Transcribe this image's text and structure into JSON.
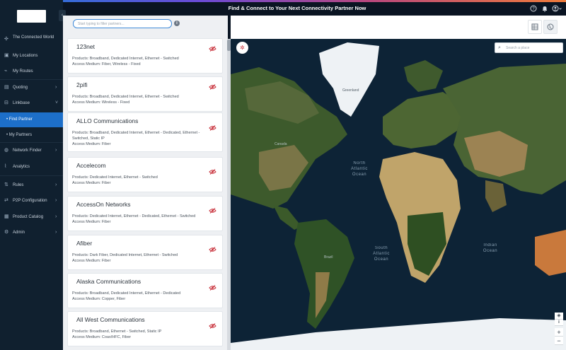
{
  "app": {
    "title": "Find & Connect to Your Next Connectivity Partner Now"
  },
  "topbar_icons": [
    "help-icon",
    "bell-icon",
    "user-icon"
  ],
  "sidebar": {
    "collapse_icon": "chevron-left-icon",
    "items": [
      {
        "label": "The Connected World",
        "icon": "network-icon",
        "chevron": false
      },
      {
        "label": "My Locations",
        "icon": "location-icon",
        "chevron": false
      },
      {
        "label": "My Routes",
        "icon": "route-icon",
        "chevron": false
      },
      {
        "label": "Quoting",
        "icon": "quote-icon",
        "chevron": true
      },
      {
        "label": "Linkbase",
        "icon": "linkbase-icon",
        "chevron": true
      },
      {
        "label": "• Find Partner",
        "icon": "",
        "chevron": false,
        "active": true
      },
      {
        "label": "• My Partners",
        "icon": "",
        "chevron": false
      },
      {
        "label": "Network Finder",
        "icon": "globe-icon",
        "chevron": true
      },
      {
        "label": "Analytics",
        "icon": "analytics-icon",
        "chevron": false
      },
      {
        "label": "Rules",
        "icon": "rules-icon",
        "chevron": true
      },
      {
        "label": "P2P Configuration",
        "icon": "p2p-icon",
        "chevron": true
      },
      {
        "label": "Product Catalog",
        "icon": "catalog-icon",
        "chevron": true
      },
      {
        "label": "Admin",
        "icon": "admin-icon",
        "chevron": true
      }
    ]
  },
  "search": {
    "placeholder": "Start typing to filter partners..."
  },
  "partners": [
    {
      "name": "123net",
      "products": "Products: Broadband, Dedicated Internet, Ethernet - Switched",
      "medium": "Access Medium: Fiber, Wireless - Fixed"
    },
    {
      "name": "2pifi",
      "products": "Products: Broadband, Dedicated Internet, Ethernet - Switched",
      "medium": "Access Medium: Wireless - Fixed"
    },
    {
      "name": "ALLO Communications",
      "products": "Products: Broadband, Dedicated Internet, Ethernet - Dedicated, Ethernet - Switched, Static IP",
      "medium": "Access Medium: Fiber"
    },
    {
      "name": "Accelecom",
      "products": "Products: Dedicated Internet, Ethernet - Switched",
      "medium": "Access Medium: Fiber"
    },
    {
      "name": "AccessOn Networks",
      "products": "Products: Dedicated Internet, Ethernet - Dedicated, Ethernet - Switched",
      "medium": "Access Medium: Fiber"
    },
    {
      "name": "Afiber",
      "products": "Products: Dark Fiber, Dedicated Internet, Ethernet - Switched",
      "medium": "Access Medium: Fiber"
    },
    {
      "name": "Alaska Communications",
      "products": "Products: Broadband, Dedicated Internet, Ethernet - Dedicated",
      "medium": "Access Medium: Copper, Fiber"
    },
    {
      "name": "All West Communications",
      "products": "Products: Broadband, Ethernet - Switched, Static IP",
      "medium": "Access Medium: Coax/HFC, Fiber"
    }
  ],
  "view_toggle": {
    "options": [
      "table-view-icon",
      "map-view-icon"
    ],
    "selected": "map-view-icon"
  },
  "map": {
    "search_placeholder": "Search a place",
    "filter_icon": "filter-off-icon",
    "ocean_labels": {
      "north_atlantic": [
        "North",
        "Atlantic",
        "Ocean"
      ],
      "south_atlantic": [
        "South",
        "Atlantic",
        "Ocean"
      ],
      "indian": [
        "Indian",
        "Ocean"
      ]
    },
    "place_labels": {
      "greenland": "Greenland",
      "canada": "Canada",
      "brazil": "Brazil"
    },
    "controls": [
      "compass-icon",
      "info-icon",
      "zoom-in-icon",
      "zoom-out-icon"
    ],
    "controls_text": {
      "zoom_in": "+",
      "zoom_out": "−"
    },
    "colors": {
      "ocean": "#0d2336",
      "land": "#3b5a2a",
      "desert": "#b79a63",
      "ice": "#eef2f5"
    }
  },
  "colors": {
    "accent": "#1d6fc9",
    "sidebar_bg": "#10202f",
    "hide_icon": "#c8303a"
  }
}
